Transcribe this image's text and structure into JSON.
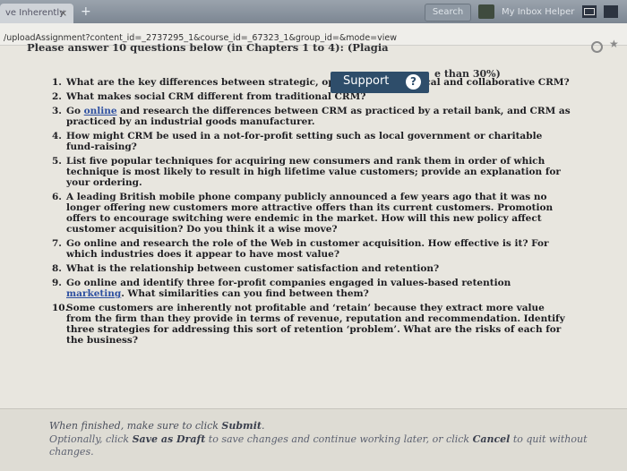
{
  "browser": {
    "tab_label": "ve Inherently",
    "tab_close": "×",
    "new_tab": "+",
    "search_button": "Search",
    "extension_label": "My Inbox Helper",
    "url": "/uploadAssignment?content_id=_2737295_1&course_id=_67323_1&group_id=&mode=view"
  },
  "page": {
    "instruction": "Please answer 10 questions below (in Chapters 1 to 4): (Plagia",
    "instruction_tail": "e than 30%)",
    "support_label": "Support",
    "support_icon": "?"
  },
  "questions": [
    {
      "number": "1.",
      "text": "What are the key differences between strategic, operational, analytical and collaborative CRM?"
    },
    {
      "number": "2.",
      "text": "What makes social CRM different from traditional CRM?"
    },
    {
      "number": "3.",
      "pre": "Go ",
      "link": "online",
      "post": " and research the differences between CRM as practiced by a retail bank, and CRM as practiced by an industrial goods manufacturer."
    },
    {
      "number": "4.",
      "text": "How might CRM be used in a not-for-profit setting such as local government or charitable fund-raising?"
    },
    {
      "number": "5.",
      "text": "List five popular techniques for acquiring new consumers and rank them in order of which technique is most likely to result in high lifetime value customers; provide an explanation for your ordering."
    },
    {
      "number": "6.",
      "text": "A leading British mobile phone company publicly announced a few years ago that it was no longer offering new customers more attractive offers than its current customers. Promotion offers to encourage switching were endemic in the market. How will this new policy affect customer acquisition? Do you think it a wise move?"
    },
    {
      "number": "7.",
      "text": "Go online and research the role of the Web in customer acquisition. How effective is it? For which industries does it appear to have most value?"
    },
    {
      "number": "8.",
      "text": "What is the relationship between customer satisfaction and retention?"
    },
    {
      "number": "9.",
      "pre": "Go online and identify three for-profit companies engaged in values-based retention ",
      "link": "marketing",
      "post": ". What similarities can you find between them?"
    },
    {
      "number": "10.",
      "text": "Some customers are inherently not profitable and ‘retain’ because they extract more value from the firm than they provide in terms of revenue, reputation and recommendation. Identify three strategies for addressing this sort of retention ‘problem’. What are the risks of each for the business?"
    }
  ],
  "footer": {
    "line1_pre": "When finished, make sure to click ",
    "line1_bold": "Submit",
    "line1_post": ".",
    "line2_pre": "Optionally, click ",
    "line2_bold": "Save as Draft",
    "line2_mid": " to save changes and continue working later, or click ",
    "line2_bold2": "Cancel",
    "line2_post": " to quit without",
    "line3": "changes."
  }
}
